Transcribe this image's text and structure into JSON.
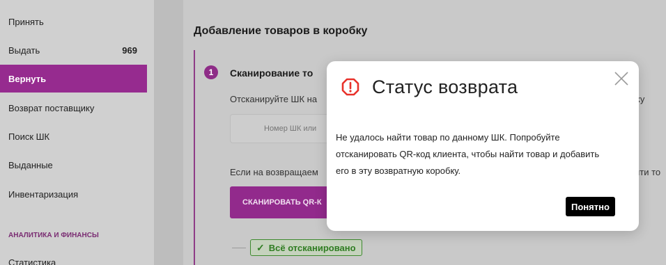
{
  "sidebar": {
    "items": [
      {
        "label": "Принять"
      },
      {
        "label": "Выдать",
        "count": "969"
      },
      {
        "label": "Вернуть"
      },
      {
        "label": "Возврат поставщику"
      },
      {
        "label": "Поиск ШК"
      },
      {
        "label": "Выданные"
      },
      {
        "label": "Инвентаризация"
      },
      {
        "label": "Статистика"
      }
    ],
    "section_title": "АНАЛИТИКА И ФИНАНСЫ",
    "active_index": 2
  },
  "main": {
    "title": "Добавление товаров в коробку",
    "step": {
      "number": "1",
      "title": "Сканирование то",
      "description": "Отсканируйте ШК на",
      "description_tail": "ку",
      "barcode_placeholder": "Номер ШК или",
      "if_text": "Если на возвращаем",
      "if_text_tail": "йти то",
      "scan_button": "СКАНИРОВАТЬ QR-К"
    },
    "done_badge": "Всё отсканировано"
  },
  "modal": {
    "title": "Статус возврата",
    "body": "Не удалось найти товар по данному ШК. Попробуйте отсканировать QR-код клиента, чтобы найти товар и добавить его в эту возвратную коробку.",
    "ok_button": "Понятно",
    "icon": "alert-hexagon-icon",
    "icon_color": "#e8312a"
  },
  "colors": {
    "accent": "#922a8c",
    "success": "#2f7d22"
  }
}
